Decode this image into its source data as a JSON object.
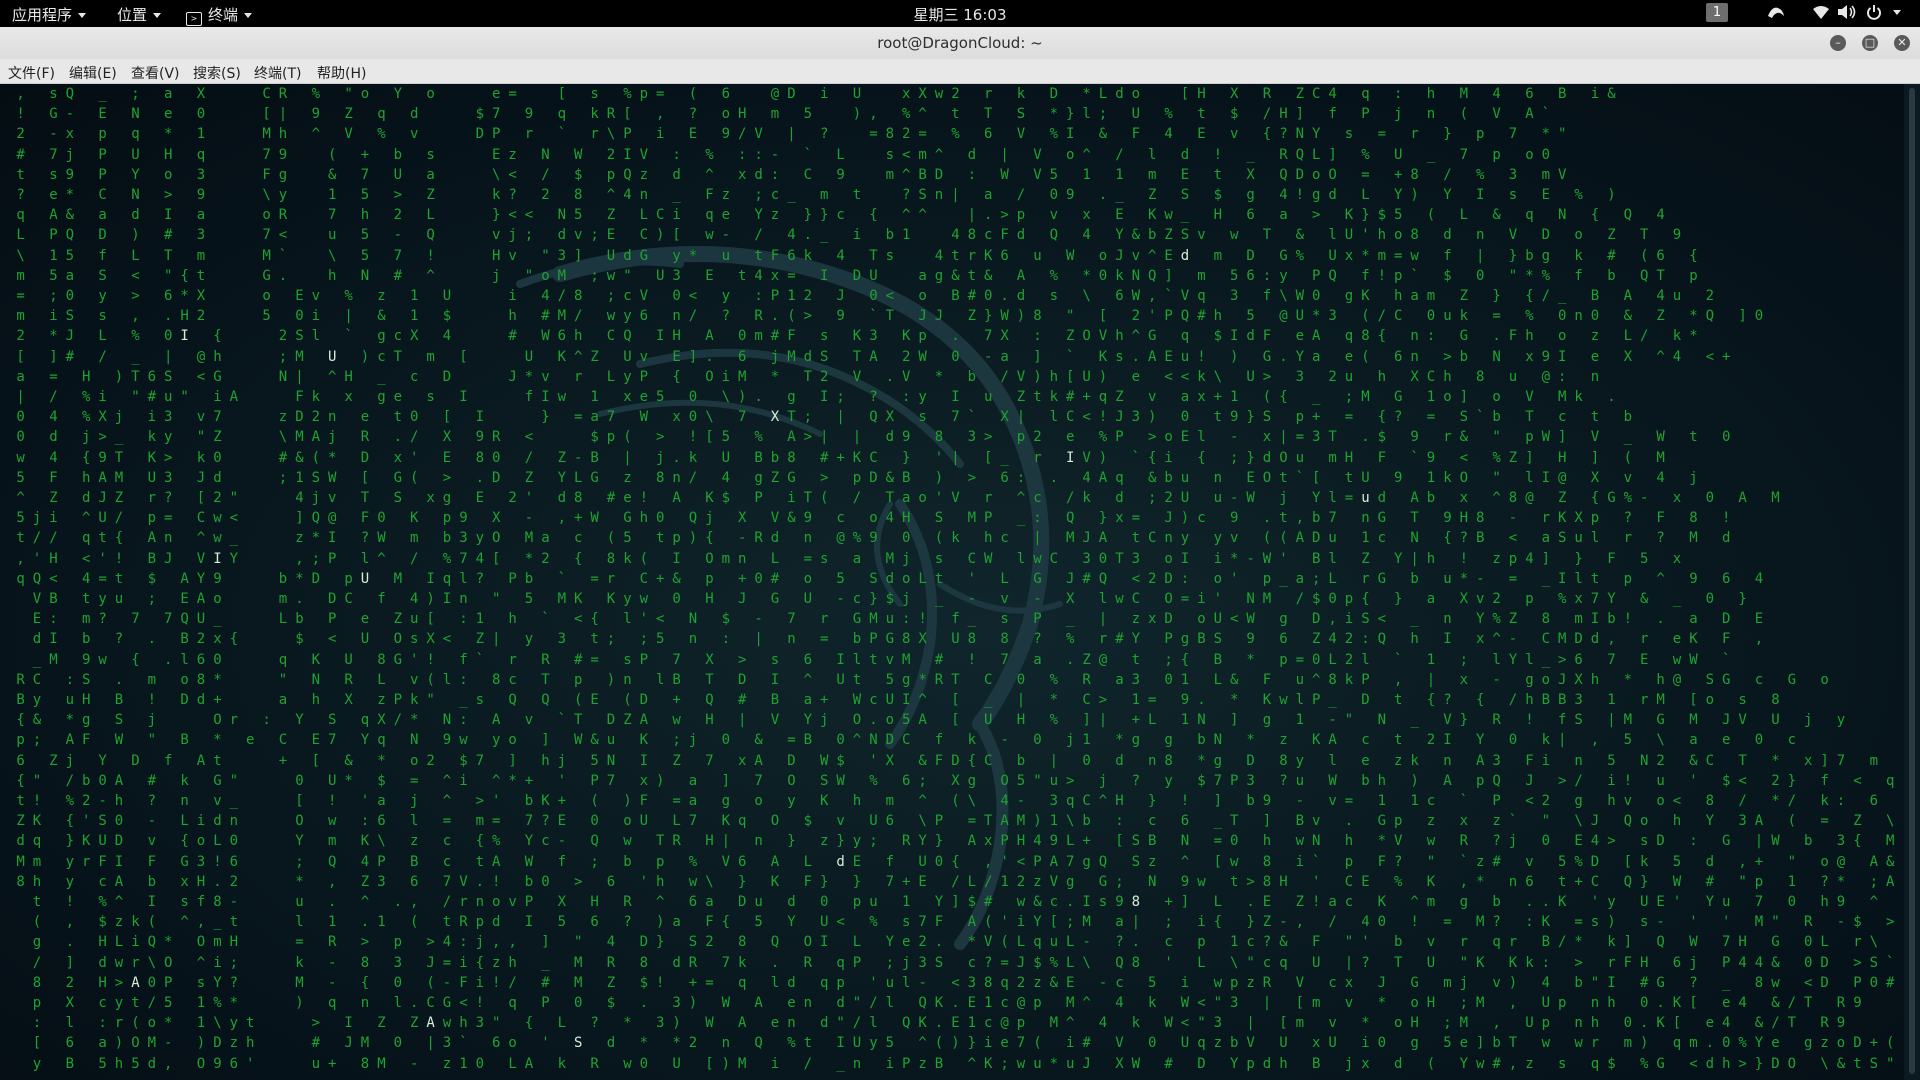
{
  "topbar": {
    "applications": "应用程序",
    "places": "位置",
    "terminal_app": "终端",
    "clock": "星期三 16:03",
    "workspace": "1"
  },
  "window": {
    "title": "root@DragonCloud: ~",
    "minimize_icon": "minimize-icon",
    "maximize_icon": "maximize-icon",
    "close_icon": "close-icon"
  },
  "menubar": {
    "file": "文件(F)",
    "edit": "编辑(E)",
    "view": "查看(V)",
    "search": "搜索(S)",
    "terminal": "终端(T)",
    "help": "帮助(H)"
  },
  "terminal": {
    "program": "cmatrix",
    "colors": {
      "rain": "#1fa330",
      "bright": "#d6f0d8",
      "background": "#0a1b21"
    },
    "rain_lines": [
      " , sQ _ ; a X   CR % \"o Y o   e=  [ s %p= ( 6  @D i U  xXw2 r k D *Ldo  [H X R ZC4 q : h M 4 6 B i&",
      " ! G- E N e 0   [| 9 Z q d   $7 9 q kR[ , ? oH m 5  ), %^ t T S *}l; U % t $ /H] f P j n ( V A`",
      " 2 -x p q * 1   Mh ^ V % v   DP r ` r\\P i E 9/V | ?  =82= % 6 V %I & F 4 E v {?NY s = r } p 7 *\"",
      " # 7j P U H q   79  ( + b s   Ez N W 2IV : % ::- ` L  s<m^ d | V o^ / l d ! _ RQL] % U _ 7 p o0",
      " t s9 P Y o 3   Fg  & 7 U a   \\< / $ pQz d ^ xd: C 9  m^BD : W V5 1 1 m E t X QDoO = +8 / % 3 mV",
      " ? e* C N > 9   \\y  1 5 > Z   k? 2 8 ^4n _ Fz ;c_ m t  ?Sn| a / 09 ._ Z S $ g 4!gd L Y) Y I s E % )",
      " q A& a d I a   oR  7 h 2 L   }<< N5 Z LCi qe Yz }}c { ^^  |.>p v x E Kw_ H 6 a > K}$5 ( L & q N { Q 4",
      " L PQ D ) # 3   7<  u 5 - Q   vj; dv;E C)[ w- / 4._ i b1  48cFd Q 4 Y&bZSv w T & lU'ho8 d n V D o Z T 9",
      " \\ 15 f L T m   M`  \\ 5 7 !   Hv \"3] UdG y* u tF6k 4 Ts  4trK6 u W oJv^Ed m D G% Ux*m=w f | }bg k # (6 {",
      " m 5a S < \"{t   G.  h N # ^   j \"oM ;w\" U3 E t4x= I DU  ag&t& A % *0kNQ] m 56:y PQ f!p` $ 0 \"*% f b QT p",
      " = ;0 y > 6*X   o Ev % z 1 U   i 4/8 ;cV 0< y :P12 J 0< o B#0.d s \\ 6W,`Vq 3 f\\W0 gK ham Z } {/_ B A 4u 2",
      " m iS s , .H2   5 0i | & 1 $   h #M/ wy6 n/ ? R.(> 9 `T JJ Z}W)8 \" [ 2'PQ#h 5 @U*3 (/C 0uk = % 0n0 & Z *Q ]0",
      " 2 *J L % 0I {   2Sl ` gcX 4   # W6h CQ IH A 0m#F s K3 Kp . 7X : ZOVh^G q $IdF eA q8{ n: G .Fh o z L/ k*",
      " [ ]# / _ | @h   ;M U )cT m [   U K^Z Uv E]. 6 jMdS TA 2W 0 -a ] ` Ks.AEu! ) G.Ya e( 6n >b N x9I e X ^4 <+",
      " a = H )T6S <G   N| ^H _ c D   J*v r LyP { OiM * T2 V .V * b /V)h[U) e <<k\\ U> 3 2u h XCh 8 u @: n",
      " | / %i \"#u\" iA   Fk x ge s I   fIw 1 xe5 0 \\). g I; ? :y I u Ztk#+qZ v ax+1 ({ _ ;M G 1o] o V Mk .",
      " 0 4 %Xj i3 v7   zD2n e t0 [ I   } =a7 W x0\\ 7 XT; | QX s 7` X| lC<!J3) 0 t9}S p+ = {? = S`b T c t b",
      " 0 d j>_ ky \"Z   \\MAj R ./ X 9R <   $p( > ![5 % A>| | d9 8 3> p2 e %P >oEl - x|=3T .$ 9 r& \" pW] V _ W t 0",
      " w 4 {9T K> k0   #&(* D x' E 80 / Z-B | j.k U Bb8 #+KC } '| [_ r IV) `{i { ;}dOu mH F `9 < %Z] H ] ( M",
      " 5 F hAM U3 Jd   ;1SW [ G( > .D Z YLG z 8n/ 4 gZG > pD&B ) > 6: . 4Aq &bu n EOt`[ tU 9 1kO \" lI@ X v 4 j",
      " ^ Z dJZ r? [2\"   4jv T S xg E 2' d8 #e! A K$ P iT( / Tao'V r ^c /k d ;2U u-W j Yl=ud Ab x ^8@ Z {G%- x 0 A M",
      " 5ji ^U/ p= Cw<   ]Q@ F0 K p9 X - ,+W Gh0 Qj X V&9 c o4H S MP _: Q }x= J)c 9 .t,b7 nG T 9H8 - rKXp ? F 8 !",
      " t// qt{ An ^w_   z*I ?W m b3yO Ma c (5 tp){ -Rd n @%9 0 (k hc | MJA tCny yv ((ADu 1c N {?B < aSul r ? M d",
      " ,'H <'! BJ VIY   ,;P l^ / %74[ *2 { 8k( I Omn L =s a Mj s CW lwC 30T3 oI i*-W' Bl Z Y|h ! zp4] } F 5 x",
      " qQ< 4=t $ AY9   b*D pU M Iql? Pb ` =r C+& p +0# o 5 SdoLt ' L G J#Q <2D: o' p_a;L rG b u*- = _Ilt p ^ 9 6 4",
      "  VB tyu ; EAo   m. DC f 4)In \" 5 MK Kyw 0 H J G U -c}$j _ - v - X lwC O=i' NM /$0p{ } a Xv2 p %x7Y & _ 0 }",
      "  E: m? 7 7QU_   Lb P e Zu[ :1 h ` <{ l'< N $ - 7 r GMu:! f_ s P _ | zxD oU<W g D,iS< _ n Y%Z 8 mIb! . a D E",
      "  dI b ? . B2x{   $ < U OsX< Z| y 3 t; ;5 n : | n = bPG8X U8 8 ? % r#Y PgBS 9 6 Z42:Q h I x^- CMDd, r eK F ,",
      "  _M 9w { .l60   q K U 8G'! f` r R #= sP 7 X > s 6 IltvM # ! 7 a .Z@ t ;{ B * p=0L2l ` 1 ; lYl_>6 7 E wW `",
      " RC :S . m o8*   \" N R L v(l: 8c T p )n lB T D I ^ Ut 5g*RT C 0 % R a3 01 L& F u^8kP , | x - goJXh * h@ SG c G o",
      " By uH B ! Dd+   a h X zPk\" _s Q Q (E (D + Q # B a+ WcUI^ [ _ | * C> 1= 9. * KwlP_ D t {? { /hBB3 1 rM [o s 8",
      " {& *g S j   Or : Y S qX/* N: A v `T DZA w H | V Yj O.o5A [ U H % ]| +L 1N ] g 1 -\" N _ V} R ! fS |M G M JV U j y",
      " p; AF W \" B * e C E7 Yq N 9w yo ] W&u K ;j 0 & =B 0^NDC f k - 0 j1 *g g bN * z KA c t 2I Y 0 k| , 5 \\ a e 0 c",
      " 6 Zj Y D f At   + [ & * o2 $7 ] hj 5N I Z 7 xA D W$ 'X &FD{C b | 0 d n8 *g D 8y l e zk n A3 Fi n 5 N2 &C T * x]7 m @ M",
      " {\" /b0A # k G\"   0 U* $ = ^i ^*+ ' P7 x) a ] 7 O SW % 6; Xg O5\"u> j ? y $7P3 ?u W bh ) A pQ J >/ i! u ' $< 2} f < qQn 2 -",
      " t! %2-h ? n v_   [ ! 'a j ^ >' bK+ ( )F =a g o y K h m ^ (\\ 4- 3qC^H } ! ] b9 - v= 1 1c ` P <2 g hv o< 8 / */ k: 6 ! :^{ e h K",
      " ZK {'S0 - Lidn   O w :6 l = m= 7?E 0 oU L7 Kq O $ v U6 \\P =TAM)1\\b : c 6 _T ] Bv . Gp z x z` \" \\J Qo h Y 3A ( = Z \\c& b",
      " dq }KUD v {oL0   Y m K\\ z c {% Yc- Q w TR H| n } z}y; RY} AxPH49L+ [SB N =0 h wN h *V w R ?j 0 E4> sD : G |W b 3{ M [:N H",
      " Mm yrFI F G3!6   ; Q 4P B c tA W f ; b p % V6 A L dE f U0{ ,'<PA7gQ Sz ^ [w 8 i` p F? \" `z# v 5%D [k 5 d ,+ \" o@ A& Tl\\ % <",
      " 8h y cA b xH.2   * , Z3 6 7V.! b0 > 6 'h w\\ } K F} } 7+E /L/12zVg G; N 9w t>8H ' CE % K ,* n6 t+C Q} W # \"p 1 ?* ;A Qw? &",
      "  t ! %^ I sf8-   u . ^ ., /rnovP X H R ^ 6a Du d 0 pu 1 Y]$# w&c.Is98 +] L .E Z!ac K ^m g b ..K 'y UE' Yu 7 0 h9 ^ % \"o S;6 b T b",
      "  ( , $zk( ^,_t   l 1 .1 ( tRpd I 5 6 ? )a F{ 5 Y U< % s7F A('iY[;M a| ; i{ }Z-, / 40 ! = M? :K =s) s- ' ' M\" R -$ >Q }i0 '",
      "  g . HLiQ* OmH   = R > p >4:j,, ] \" 4 D} S2 8 Q OI L Ye2. *V(LquL- ?. c p 1c?& F \"' b v r qr B/* k] Q W 7H G 0L r\\ I8Y > {",
      "  / ] dwr\\O ^i;   k - 8 3 J=i{zh _ M R 8 dR 7k . R qP ;j3S c?=J$%L\\ Q8 ' L \\\"cq U |? T U \"K Kk: > rFH 6j P44& 0D >S` J H",
      "  8 2 H>A0P sY?   M - { 0 (-Fi!/ # M Z $! += q ld qp 'ul- <38q2z&E -c 5 i wpzR V cx J G mj v) 4 b\"I #G ? _ 8w <D P0# CF 8",
      "  p X cyt/5 1%*   ) q n l.CG<! q P 0 $ . 3) W A en d\"/l QK.E1c@p M^ 4 k W<\"3 | [m v * oH ;M , Up nh 0.K[ e4 &/T R9",
      "  : l :r(o* 1\\yt   > I Z ZAwh3\" { L ? * 3) W A en d\"/l QK.E1c@p M^ 4 k W<\"3 | [m v * oH ;M , Up nh 0.K[ e4 &/T R9",
      "  [ 6 a)OM- )Dzh   # JM 0 |3` 6o ' S d * *2 n Q %t IUy5 ^()}ie7( i# V 0 UqzbV U xU i0 g 5e]bT w wr m) qm.0%Ye gzoD+( K",
      "  y B 5h5d, O96'   u+ 8M - z10 LA k R w0 U [)M i / _n iPzB ^K;wu*uJ XW # D Ypdh B jx d ( Yw#,z s q$ %G <dh>}DO \\&tS\"H y"
    ],
    "bright_glyphs": [
      "z",
      "r",
      "f",
      "8",
      "{",
      "u",
      "0",
      "+",
      "6",
      "8",
      "o",
      "l",
      "S",
      "A",
      "G",
      "h",
      "N",
      "M",
      "U",
      "g",
      "X",
      "I",
      "R",
      "3",
      "9",
      "K",
      "d",
      "h"
    ]
  }
}
